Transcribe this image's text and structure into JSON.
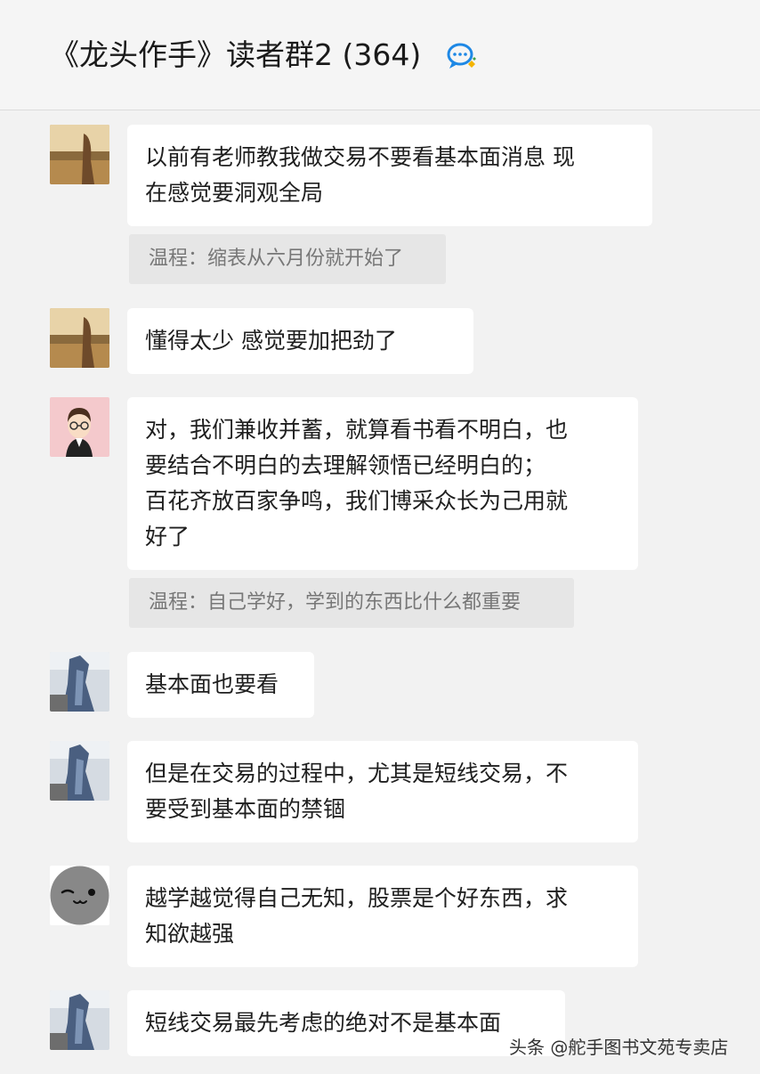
{
  "header": {
    "title": "《龙头作手》读者群2 (364)"
  },
  "messages": [
    {
      "lines": [
        "以前有老师教我做交易不要看基本面消息  现",
        "在感觉要洞观全局"
      ],
      "quote": "温程：缩表从六月份就开始了"
    },
    {
      "lines": [
        "懂得太少  感觉要加把劲了"
      ]
    },
    {
      "lines": [
        "对，我们兼收并蓄，就算看书看不明白，也",
        "要结合不明白的去理解领悟已经明白的；",
        "百花齐放百家争鸣，我们博采众长为己用就",
        "好了"
      ],
      "quote": "温程：自己学好，学到的东西比什么都重要"
    },
    {
      "lines": [
        "基本面也要看"
      ]
    },
    {
      "lines": [
        "但是在交易的过程中，尤其是短线交易，不",
        "要受到基本面的禁锢"
      ]
    },
    {
      "lines": [
        "越学越觉得自己无知，股票是个好东西，求",
        "知欲越强"
      ]
    },
    {
      "lines": [
        "短线交易最先考虑的绝对不是基本面"
      ]
    }
  ],
  "watermark": "头条 @舵手图书文苑专卖店"
}
